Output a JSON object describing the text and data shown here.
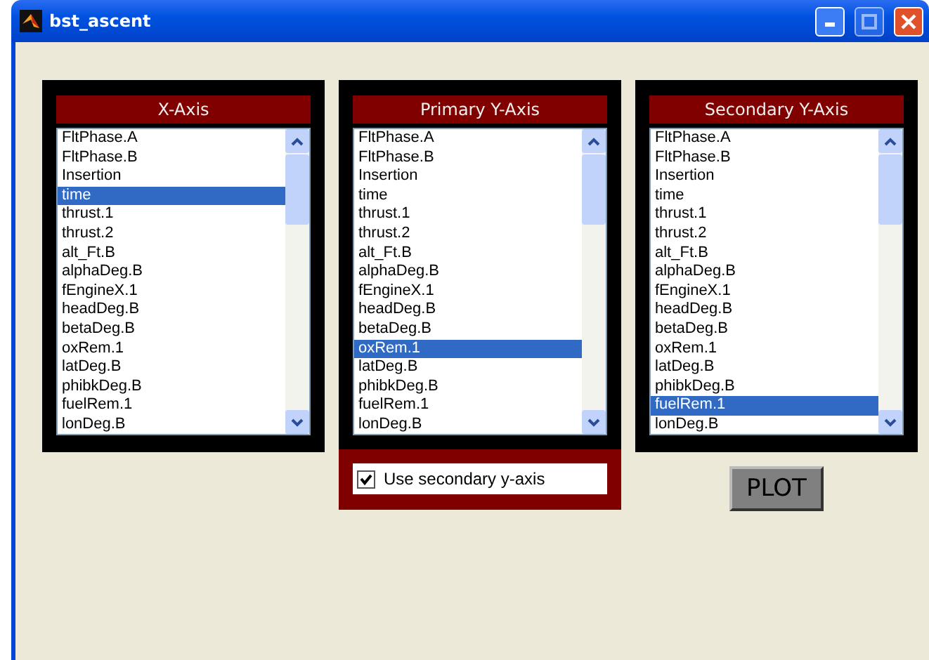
{
  "window": {
    "title": "bst_ascent"
  },
  "panels": [
    {
      "title": "X-Axis",
      "items": [
        {
          "label": "FltPhase.A",
          "selected": false
        },
        {
          "label": "FltPhase.B",
          "selected": false
        },
        {
          "label": "Insertion",
          "selected": false
        },
        {
          "label": "time",
          "selected": true
        },
        {
          "label": "thrust.1",
          "selected": false
        },
        {
          "label": "thrust.2",
          "selected": false
        },
        {
          "label": "alt_Ft.B",
          "selected": false
        },
        {
          "label": "alphaDeg.B",
          "selected": false
        },
        {
          "label": "fEngineX.1",
          "selected": false
        },
        {
          "label": "headDeg.B",
          "selected": false
        },
        {
          "label": "betaDeg.B",
          "selected": false
        },
        {
          "label": "oxRem.1",
          "selected": false
        },
        {
          "label": "latDeg.B",
          "selected": false
        },
        {
          "label": "phibkDeg.B",
          "selected": false
        },
        {
          "label": "fuelRem.1",
          "selected": false
        },
        {
          "label": "lonDeg.B",
          "selected": false
        }
      ]
    },
    {
      "title": "Primary Y-Axis",
      "items": [
        {
          "label": "FltPhase.A",
          "selected": false
        },
        {
          "label": "FltPhase.B",
          "selected": false
        },
        {
          "label": "Insertion",
          "selected": false
        },
        {
          "label": "time",
          "selected": false
        },
        {
          "label": "thrust.1",
          "selected": false
        },
        {
          "label": "thrust.2",
          "selected": false
        },
        {
          "label": "alt_Ft.B",
          "selected": false
        },
        {
          "label": "alphaDeg.B",
          "selected": false
        },
        {
          "label": "fEngineX.1",
          "selected": false
        },
        {
          "label": "headDeg.B",
          "selected": false
        },
        {
          "label": "betaDeg.B",
          "selected": false
        },
        {
          "label": "oxRem.1",
          "selected": true
        },
        {
          "label": "latDeg.B",
          "selected": false
        },
        {
          "label": "phibkDeg.B",
          "selected": false
        },
        {
          "label": "fuelRem.1",
          "selected": false
        },
        {
          "label": "lonDeg.B",
          "selected": false
        }
      ]
    },
    {
      "title": "Secondary Y-Axis",
      "items": [
        {
          "label": "FltPhase.A",
          "selected": false
        },
        {
          "label": "FltPhase.B",
          "selected": false
        },
        {
          "label": "Insertion",
          "selected": false
        },
        {
          "label": "time",
          "selected": false
        },
        {
          "label": "thrust.1",
          "selected": false
        },
        {
          "label": "thrust.2",
          "selected": false
        },
        {
          "label": "alt_Ft.B",
          "selected": false
        },
        {
          "label": "alphaDeg.B",
          "selected": false
        },
        {
          "label": "fEngineX.1",
          "selected": false
        },
        {
          "label": "headDeg.B",
          "selected": false
        },
        {
          "label": "betaDeg.B",
          "selected": false
        },
        {
          "label": "oxRem.1",
          "selected": false
        },
        {
          "label": "latDeg.B",
          "selected": false
        },
        {
          "label": "phibkDeg.B",
          "selected": false
        },
        {
          "label": "fuelRem.1",
          "selected": true
        },
        {
          "label": "lonDeg.B",
          "selected": false
        }
      ]
    }
  ],
  "secondary_axis_checkbox": {
    "label": "Use secondary y-axis",
    "checked": true
  },
  "plot_button": {
    "label": "PLOT"
  }
}
